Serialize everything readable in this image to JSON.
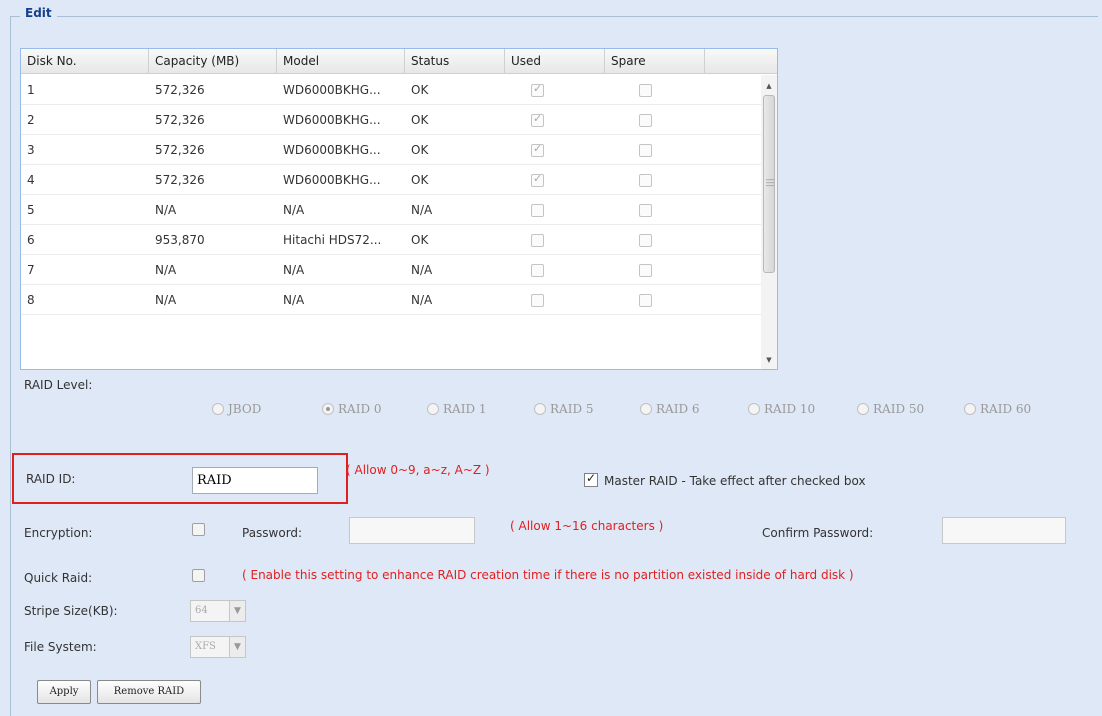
{
  "legend": "Edit",
  "grid": {
    "columns": [
      "Disk No.",
      "Capacity (MB)",
      "Model",
      "Status",
      "Used",
      "Spare"
    ],
    "rows": [
      {
        "disk": "1",
        "capacity": "572,326",
        "model": "WD6000BKHG...",
        "status": "OK",
        "used": true,
        "spare": false
      },
      {
        "disk": "2",
        "capacity": "572,326",
        "model": "WD6000BKHG...",
        "status": "OK",
        "used": true,
        "spare": false
      },
      {
        "disk": "3",
        "capacity": "572,326",
        "model": "WD6000BKHG...",
        "status": "OK",
        "used": true,
        "spare": false
      },
      {
        "disk": "4",
        "capacity": "572,326",
        "model": "WD6000BKHG...",
        "status": "OK",
        "used": true,
        "spare": false
      },
      {
        "disk": "5",
        "capacity": "N/A",
        "model": "N/A",
        "status": "N/A",
        "used": false,
        "spare": false
      },
      {
        "disk": "6",
        "capacity": "953,870",
        "model": "Hitachi HDS72...",
        "status": "OK",
        "used": false,
        "spare": false
      },
      {
        "disk": "7",
        "capacity": "N/A",
        "model": "N/A",
        "status": "N/A",
        "used": false,
        "spare": false
      },
      {
        "disk": "8",
        "capacity": "N/A",
        "model": "N/A",
        "status": "N/A",
        "used": false,
        "spare": false
      }
    ]
  },
  "raid_level": {
    "label": "RAID Level:",
    "options": [
      "JBOD",
      "RAID 0",
      "RAID 1",
      "RAID 5",
      "RAID 6",
      "RAID 10",
      "RAID 50",
      "RAID 60"
    ],
    "selected": "RAID 0"
  },
  "raid_id": {
    "label": "RAID ID:",
    "value": "RAID",
    "hint": "( Allow 0~9, a~z, A~Z )"
  },
  "master_raid": {
    "label": "Master RAID - Take effect after checked box",
    "checked": true
  },
  "encryption": {
    "label": "Encryption:",
    "password_label": "Password:",
    "password_hint": "( Allow 1~16 characters )",
    "confirm_label": "Confirm Password:"
  },
  "quick_raid": {
    "label": "Quick Raid:",
    "hint": "( Enable this setting to enhance RAID creation time if there is no partition existed inside of hard disk )"
  },
  "stripe_size": {
    "label": "Stripe Size(KB):",
    "value": "64"
  },
  "file_system": {
    "label": "File System:",
    "value": "XFS"
  },
  "buttons": {
    "apply": "Apply",
    "remove": "Remove RAID"
  },
  "colors": {
    "background": "#dfe8f6",
    "hint_red": "#e02020",
    "highlight_box": "#e02020"
  }
}
